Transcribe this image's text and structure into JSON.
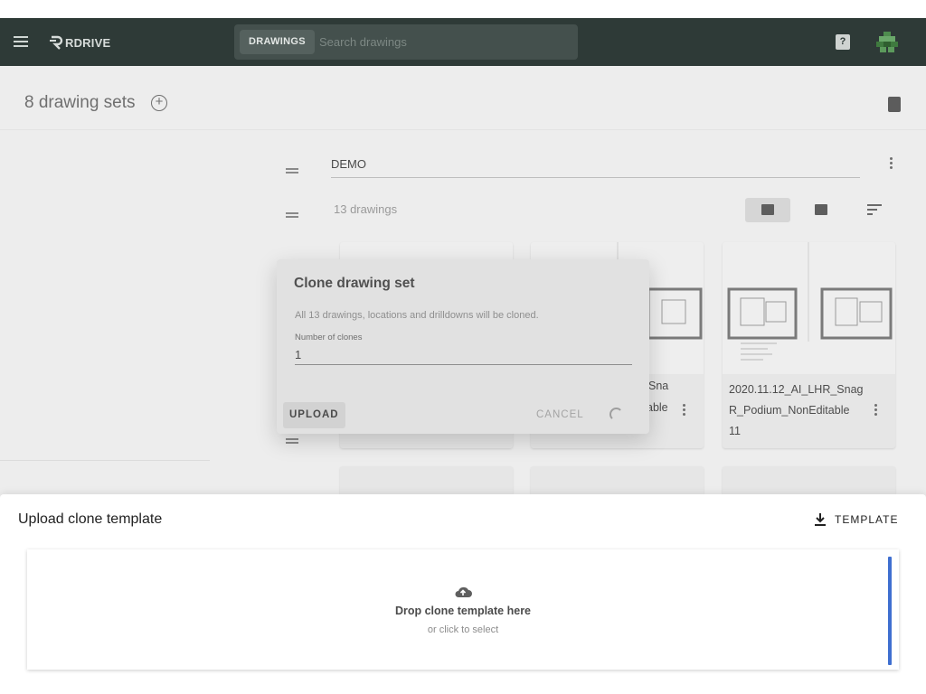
{
  "topbar": {
    "logo_text": "RDRIVE",
    "search": {
      "scope_label": "DRAWINGS",
      "placeholder": "Search drawings"
    },
    "help_glyph": "?"
  },
  "content": {
    "sets_title": "8 drawing sets",
    "add_glyph": "+",
    "set": {
      "name": "DEMO",
      "drawing_count": "13 drawings"
    },
    "cards": [
      {
        "title": ""
      },
      {
        "title": "",
        "title_fragment": "Sna",
        "title_fragment_2": "able"
      },
      {
        "title": "2020.11.12_AI_LHR_SnagR_Podium_NonEditable",
        "number": "11"
      }
    ]
  },
  "modal": {
    "title": "Clone drawing set",
    "description": "All 13 drawings, locations and drilldowns will be cloned.",
    "field_label": "Number of clones",
    "field_value": "1",
    "upload_label": "UPLOAD",
    "cancel_label": "CANCEL"
  },
  "sheet": {
    "title": "Upload clone template",
    "template_label": "TEMPLATE",
    "dropzone": {
      "main_text": "Drop clone template here",
      "sub_text": "or click to select"
    }
  },
  "icons": {
    "menu": "menu-icon",
    "help": "help-icon",
    "add": "add-circle-icon",
    "book": "book-icon",
    "drag": "drag-handle-icon",
    "more": "more-vert-icon",
    "image_view": "image-icon",
    "gallery_view": "gallery-icon",
    "sort": "sort-icon",
    "download": "download-icon",
    "cloud_upload": "cloud-upload-icon"
  },
  "colors": {
    "topbar": "#2e3a37",
    "accent": "#3f6fd0",
    "backdrop": "#ededed"
  }
}
